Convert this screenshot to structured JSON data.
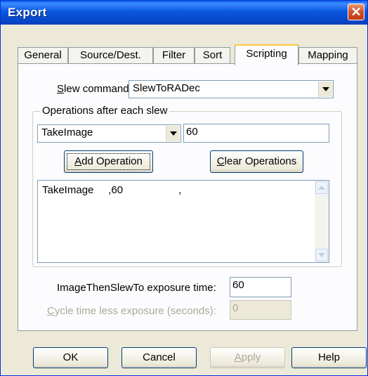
{
  "window": {
    "title": "Export",
    "close_label": "✕"
  },
  "tabs": [
    {
      "label": "General"
    },
    {
      "label": "Source/Dest."
    },
    {
      "label": "Filter"
    },
    {
      "label": "Sort"
    },
    {
      "label": "Scripting",
      "selected": true
    },
    {
      "label": "Mapping"
    }
  ],
  "slew": {
    "label_first": "S",
    "label_rest": "lew command:",
    "value": "SlewToRADec"
  },
  "operations": {
    "group_label": "Operations after each slew",
    "operation_value": "TakeImage",
    "param_value": "60",
    "add_first": "A",
    "add_rest": "dd Operation",
    "clear_first": "C",
    "clear_rest": "lear Operations",
    "list_items": [
      "TakeImage     ,60                   ,"
    ]
  },
  "exposure": {
    "label": "ImageThenSlewTo exposure time:",
    "value": "60"
  },
  "cycle": {
    "label_first": "C",
    "label_rest": "ycle time less exposure (seconds):",
    "value": "0"
  },
  "buttons": {
    "ok": "OK",
    "cancel": "Cancel",
    "apply_first": "A",
    "apply_rest": "pply",
    "help": "Help"
  },
  "colors": {
    "titlebar": "#0a58e0",
    "dialog_bg": "#ece9d8",
    "panel_bg": "#fcfcfe",
    "active_tab_accent": "#ffc83c"
  }
}
